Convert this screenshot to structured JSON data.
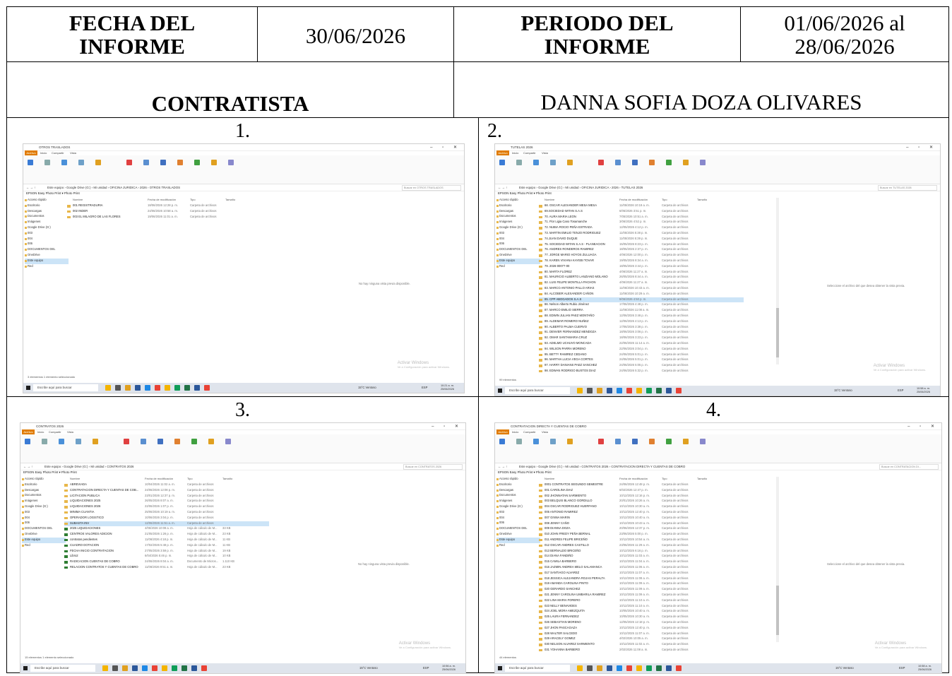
{
  "header": {
    "fecha_label": "FECHA DEL INFORME",
    "fecha_value": "30/06/2026",
    "periodo_label": "PERIODO DEL INFORME",
    "periodo_value_line1": "01/06/2026 al",
    "periodo_value_line2": "28/06/2026",
    "contratista_label": "CONTRATISTA",
    "contratista_value": "DANNA SOFIA DOZA OLIVARES"
  },
  "panels": [
    {
      "number": "1.",
      "window_title": "OTROS TRASLADOS",
      "path": "Este equipo › Google Drive (G:) › Mi unidad › OFICINA JURIDICA › 2026 › OTROS TRASLADOS",
      "search": "Buscar en OTROS TRASLADOS",
      "empty_message": "No hay ninguna vista previa disponible.",
      "status": "3 elementos    1 elemento seleccionado",
      "time": "10:21 a. m.",
      "date": "25/06/2026",
      "items": [
        {
          "name": "001 REGISTRADURIA",
          "date": "18/06/2026 12:28 p. m.",
          "type": "Carpeta de archivos",
          "size": ""
        },
        {
          "name": "002 INDER",
          "date": "24/06/2026 10:58 a. m.",
          "type": "Carpeta de archivos",
          "size": ""
        },
        {
          "name": "003 EL MILAGRO DE LAS FLORES",
          "date": "19/06/2026 11:01 a. m.",
          "type": "Carpeta de archivos",
          "size": ""
        }
      ]
    },
    {
      "number": "2.",
      "window_title": "TUTELAS 2026",
      "path": "Este equipo › Google Drive (G:) › Mi unidad › OFICINA JURIDICA › 2026 › TUTELAS 2026",
      "search": "Buscar en TUTELAS 2026",
      "empty_message": "Seleccione el archivo del que desea obtener la vista previa.",
      "status": "99 elementos",
      "time": "10:58 a. m.",
      "date": "25/06/2026",
      "items": [
        {
          "name": "68. OSCAR ALEXANDER MESA MESA",
          "date": "11/05/2026 10:19 a. m.",
          "type": "Carpeta de archivos",
          "size": ""
        },
        {
          "name": "69.SOCIEDAD WITAN S.A.S",
          "date": "6/05/2026 3:51 p. m.",
          "type": "Carpeta de archivos",
          "size": ""
        },
        {
          "name": "70. AURA MARIA LEON",
          "date": "7/05/2026 10:51 a. m.",
          "type": "Carpeta de archivos",
          "size": ""
        },
        {
          "name": "71. Flor Ligia Cano Tosamanche",
          "date": "3/06/2026 4:52 p. m.",
          "type": "Carpeta de archivos",
          "size": ""
        },
        {
          "name": "72. NUBIA ROCIO PEÑA ESTRADA",
          "date": "12/05/2026 4:12 p. m.",
          "type": "Carpeta de archivos",
          "size": ""
        },
        {
          "name": "73. MARTIN EMILIO TENJO RODRIGUEZ",
          "date": "11/05/2026 5:38 p. m.",
          "type": "Carpeta de archivos",
          "size": ""
        },
        {
          "name": "74.JUAN DAVID DUQUE",
          "date": "11/05/2026 5:39 p. m.",
          "type": "Carpeta de archivos",
          "size": ""
        },
        {
          "name": "75. SOCIEDAD WITAN S.A.S - PLANEACION",
          "date": "15/05/2026 8:23 p. m.",
          "type": "Carpeta de archivos",
          "size": ""
        },
        {
          "name": "76. ANDRES RONDEROS RAMIREZ",
          "date": "18/05/2026 2:37 p. m.",
          "type": "Carpeta de archivos",
          "size": ""
        },
        {
          "name": "77. JORGE MARIO HOYOS ZULUAGA",
          "date": "4/06/2026 12:00 p. m.",
          "type": "Carpeta de archivos",
          "size": ""
        },
        {
          "name": "78. KAREN VIVIANA KAYEBI TOVAR",
          "date": "19/05/2026 8:34 a. m.",
          "type": "Carpeta de archivos",
          "size": ""
        },
        {
          "name": "79. 2026-00077-00",
          "date": "18/05/2026 3:44 p. m.",
          "type": "Carpeta de archivos",
          "size": ""
        },
        {
          "name": "80. MARTA FLOREZ",
          "date": "4/06/2026 11:27 a. m.",
          "type": "Carpeta de archivos",
          "size": ""
        },
        {
          "name": "81. MAURICIO ALBERTO LANZIANO MOLANO",
          "date": "26/05/2026 8:44 a. m.",
          "type": "Carpeta de archivos",
          "size": ""
        },
        {
          "name": "82. LUIS FELIPE MONTILLA PACHON",
          "date": "4/06/2026 11:27 a. m.",
          "type": "Carpeta de archivos",
          "size": ""
        },
        {
          "name": "83. MARCO ANTONIO PALLO ARIAS",
          "date": "11/06/2026 10:43 a. m.",
          "type": "Carpeta de archivos",
          "size": ""
        },
        {
          "name": "84. ALCOBER ALEXANDER CAÑON",
          "date": "11/06/2026 10:29 a. m.",
          "type": "Carpeta de archivos",
          "size": ""
        },
        {
          "name": "85. CPP ABOGADOS S.A.S",
          "date": "9/06/2026 4:50 p. m.",
          "type": "Carpeta de archivos",
          "size": "",
          "selected": true
        },
        {
          "name": "86. Nelson Alberto Rubio Jiménez",
          "date": "17/06/2026 4:48 p. m.",
          "type": "Carpeta de archivos",
          "size": ""
        },
        {
          "name": "87. MARCO EMILIO SIERRA",
          "date": "11/06/2026 11:08 a. m.",
          "type": "Carpeta de archivos",
          "size": ""
        },
        {
          "name": "88. EDWIN JULIAN PAEZ MONTAÑO",
          "date": "12/06/2026 3:46 p. m.",
          "type": "Carpeta de archivos",
          "size": ""
        },
        {
          "name": "89. ALDEMAR ROMERO NUÑEZ",
          "date": "12/06/2026 4:13 p. m.",
          "type": "Carpeta de archivos",
          "size": ""
        },
        {
          "name": "90. ALBERTO PALMA CUERVO",
          "date": "17/06/2026 3:38 p. m.",
          "type": "Carpeta de archivos",
          "size": ""
        },
        {
          "name": "91. DENVER FERNANDEZ MENDOZA",
          "date": "18/06/2026 3:06 p. m.",
          "type": "Carpeta de archivos",
          "size": ""
        },
        {
          "name": "92. OMAR SANTAMARIA CRUZ",
          "date": "18/06/2026 3:23 p. m.",
          "type": "Carpeta de archivos",
          "size": ""
        },
        {
          "name": "93. ADELMO UCHUVO MONCADA",
          "date": "22/06/2026 11:14 a. m.",
          "type": "Carpeta de archivos",
          "size": ""
        },
        {
          "name": "94. WILSON PARRA MORENO",
          "date": "22/06/2026 3:04 p. m.",
          "type": "Carpeta de archivos",
          "size": ""
        },
        {
          "name": "95. BETTY RAMIREZ CEDANO",
          "date": "24/06/2026 5:01 p. m.",
          "type": "Carpeta de archivos",
          "size": ""
        },
        {
          "name": "96. MARTHA LUCIA VEGA CORTES",
          "date": "24/06/2026 5:01 p. m.",
          "type": "Carpeta de archivos",
          "size": ""
        },
        {
          "name": "97. HARRY DANIANS PAEZ SANCHEZ",
          "date": "24/06/2026 5:05 p. m.",
          "type": "Carpeta de archivos",
          "size": ""
        },
        {
          "name": "98. EDWAN RODRIGO BUSTOS DIAZ",
          "date": "24/06/2026 5:32 p. m.",
          "type": "Carpeta de archivos",
          "size": ""
        },
        {
          "name": "CUADRO DE CONTROL TUTELA",
          "date": "25/06/2026 10:23 a. m.",
          "type": "Hoja de cálculo de M...",
          "size": "90 KB"
        }
      ]
    },
    {
      "number": "3.",
      "window_title": "CONTRATOS 2026",
      "path": "Este equipo › Google Drive (G:) › Mi unidad › CONTRATOS 2026",
      "search": "Buscar en CONTRATOS 2026",
      "empty_message": "No hay ninguna vista previa disponible.",
      "status": "15 elementos    1 elemento seleccionado",
      "time": "10:56 a. m.",
      "date": "25/06/2026",
      "items": [
        {
          "name": "ABREVIADA",
          "date": "10/04/2026 11:02 a. m.",
          "type": "Carpeta de archivos",
          "size": ""
        },
        {
          "name": "CONTRATACION DIRECTA Y CUENTAS DE COB...",
          "date": "24/06/2026 12:08 p. m.",
          "type": "Carpeta de archivos",
          "size": ""
        },
        {
          "name": "LICITACION PUBLICA",
          "date": "23/01/2026 12:37 p. m.",
          "type": "Carpeta de archivos",
          "size": ""
        },
        {
          "name": "LIQUIDACIONES 2025",
          "date": "26/05/2026 8:07 a. m.",
          "type": "Carpeta de archivos",
          "size": ""
        },
        {
          "name": "LIQUIDACIONES 2026",
          "date": "22/06/2026 1:07 p. m.",
          "type": "Carpeta de archivos",
          "size": ""
        },
        {
          "name": "MINIMA CUANTIA",
          "date": "25/06/2026 10:19 a. m.",
          "type": "Carpeta de archivos",
          "size": ""
        },
        {
          "name": "OPERADOR LOGISTICO",
          "date": "10/06/2026 3:04 p. m.",
          "type": "Carpeta de archivos",
          "size": ""
        },
        {
          "name": "SUBASTA INV",
          "date": "12/06/2026 11:51 a. m.",
          "type": "Carpeta de archivos",
          "size": "",
          "selected": true
        },
        {
          "name": "2025 LIQUIDACIONES",
          "date": "4/05/2026 10:08 a. m.",
          "type": "Hoja de cálculo de M...",
          "size": "33 KB"
        },
        {
          "name": "CENTROS VALORES ADICION",
          "date": "21/05/2026 1:26 p. m.",
          "type": "Hoja de cálculo de M...",
          "size": "23 KB"
        },
        {
          "name": "contratos pendientes",
          "date": "11/06/2026 4:18 p. m.",
          "type": "Hoja de cálculo de M...",
          "size": "11 KB"
        },
        {
          "name": "CUADRO DOTACION",
          "date": "17/02/2026 5:48 p. m.",
          "type": "Hoja de cálculo de M...",
          "size": "11 KB"
        },
        {
          "name": "FECHA INICIO CONTRATACION",
          "date": "27/05/2026 3:59 p. m.",
          "type": "Hoja de cálculo de M...",
          "size": "19 KB"
        },
        {
          "name": "Libro2",
          "date": "6/04/2026 5:46 p. m.",
          "type": "Hoja de cálculo de M...",
          "size": "10 KB"
        },
        {
          "name": "RADICACION CUENTAS DE COBRO",
          "date": "24/06/2026 8:04 a. m.",
          "type": "Documento de Micros...",
          "size": "1.110 KB"
        },
        {
          "name": "RELACION CONTRATOS Y CUENTAS DE COBRO",
          "date": "11/06/2026 9:51 a. m.",
          "type": "Hoja de cálculo de M...",
          "size": "23 KB"
        }
      ]
    },
    {
      "number": "4.",
      "window_title": "CONTRATACION DIRECTA Y CUENTAS DE COBRO",
      "path": "Este equipo › Google Drive (G:) › Mi unidad › CONTRATOS 2026 › CONTRATACION DIRECTA Y CUENTAS DE COBRO",
      "search": "Buscar en CONTRATACION DI...",
      "empty_message": "Seleccione el archivo del que desea obtener la vista previa.",
      "status": "44 elementos",
      "time": "10:58 a. m.",
      "date": "25/06/2026",
      "items": [
        {
          "name": "0001 CONTRATOS SEGUNDO SEMESTRE",
          "date": "24/06/2026 12:48 p. m.",
          "type": "Carpeta de archivos",
          "size": ""
        },
        {
          "name": "001 CAROLINA DIAZ",
          "date": "6/02/2026 12:47 p. m.",
          "type": "Carpeta de archivos",
          "size": ""
        },
        {
          "name": "002 JHONNATAN SARMIENTO",
          "date": "10/12/2025 12:16 p. m.",
          "type": "Carpeta de archivos",
          "size": ""
        },
        {
          "name": "003 BELQUIS BLANCO GORDILLO",
          "date": "20/01/2026 10:26 a. m.",
          "type": "Carpeta de archivos",
          "size": ""
        },
        {
          "name": "004 OSCAR RODRIGUEZ HUERFANO",
          "date": "10/12/2025 10:30 a. m.",
          "type": "Carpeta de archivos",
          "size": ""
        },
        {
          "name": "005 ANTONIO RAMIREZ",
          "date": "10/12/2025 12:40 p. m.",
          "type": "Carpeta de archivos",
          "size": ""
        },
        {
          "name": "007 GINNA MARIN",
          "date": "10/12/2025 10:40 a. m.",
          "type": "Carpeta de archivos",
          "size": ""
        },
        {
          "name": "008 JENNY CAÑO",
          "date": "10/12/2025 10:43 a. m.",
          "type": "Carpeta de archivos",
          "size": ""
        },
        {
          "name": "009 DIANNA DOZA",
          "date": "20/06/2026 12:37 p. m.",
          "type": "Carpeta de archivos",
          "size": ""
        },
        {
          "name": "010 JOHN FREDY PEÑA BERNAL",
          "date": "23/06/2026 5:00 p. m.",
          "type": "Carpeta de archivos",
          "size": ""
        },
        {
          "name": "011 ANDRES FELIPE BRICEÑO",
          "date": "10/12/2025 10:54 a. m.",
          "type": "Carpeta de archivos",
          "size": ""
        },
        {
          "name": "012 OSCAR ANDRES CASTILLO",
          "date": "23/06/2026 11:29 a. m.",
          "type": "Carpeta de archivos",
          "size": ""
        },
        {
          "name": "013 BERNALDO BRICEÑO",
          "date": "10/12/2025 6:16 p. m.",
          "type": "Carpeta de archivos",
          "size": ""
        },
        {
          "name": "014 DIANA FANDIÑO",
          "date": "10/12/2025 11:03 a. m.",
          "type": "Carpeta de archivos",
          "size": ""
        },
        {
          "name": "015 CAMILA BARBERO",
          "date": "10/12/2025 11:04 a. m.",
          "type": "Carpeta de archivos",
          "size": ""
        },
        {
          "name": "016 JAZMIN ANDREA MELO SALAMANCA",
          "date": "10/12/2025 11:06 a. m.",
          "type": "Carpeta de archivos",
          "size": ""
        },
        {
          "name": "017 SANTIAGO ALVAREZ",
          "date": "10/12/2025 11:07 a. m.",
          "type": "Carpeta de archivos",
          "size": ""
        },
        {
          "name": "018 JESSICA ALEJANDRA ROJAS PERALTA",
          "date": "10/12/2025 11:08 a. m.",
          "type": "Carpeta de archivos",
          "size": ""
        },
        {
          "name": "019 AMANDA CAROLINA PINTO",
          "date": "10/12/2025 11:09 a. m.",
          "type": "Carpeta de archivos",
          "size": ""
        },
        {
          "name": "020 GERARDO SANCHEZ",
          "date": "10/12/2025 11:09 a. m.",
          "type": "Carpeta de archivos",
          "size": ""
        },
        {
          "name": "021 JENNY CAROLINA UMBARILA RAMIREZ",
          "date": "10/12/2025 11:09 a. m.",
          "type": "Carpeta de archivos",
          "size": ""
        },
        {
          "name": "022 LINA MARIA FORERO",
          "date": "10/12/2025 11:10 a. m.",
          "type": "Carpeta de archivos",
          "size": ""
        },
        {
          "name": "023 NELLY BENAVIDES",
          "date": "10/12/2025 11:10 a. m.",
          "type": "Carpeta de archivos",
          "size": ""
        },
        {
          "name": "024 JOEL MORA AMEZQUITA",
          "date": "10/05/2026 10:40 a. m.",
          "type": "Carpeta de archivos",
          "size": ""
        },
        {
          "name": "025 LAURA FERNANDEZ",
          "date": "10/05/2026 10:30 a. m.",
          "type": "Carpeta de archivos",
          "size": ""
        },
        {
          "name": "026 SEBASTIAN MORENO",
          "date": "12/05/2026 12:18 p. m.",
          "type": "Carpeta de archivos",
          "size": ""
        },
        {
          "name": "027 JHON PASCAGAZA",
          "date": "10/12/2025 12:40 p. m.",
          "type": "Carpeta de archivos",
          "size": ""
        },
        {
          "name": "028 WALTER SALCEDO",
          "date": "10/12/2025 11:07 a. m.",
          "type": "Carpeta de archivos",
          "size": ""
        },
        {
          "name": "029 ARACELY GOMEZ",
          "date": "4/02/2026 10:05 a. m.",
          "type": "Carpeta de archivos",
          "size": ""
        },
        {
          "name": "030 NELSON ALVAREZ SARMIENTO",
          "date": "10/12/2025 11:02 a. m.",
          "type": "Carpeta de archivos",
          "size": ""
        },
        {
          "name": "031 YOHANNA BARBERO",
          "date": "2/02/2026 11:08 a. m.",
          "type": "Carpeta de archivos",
          "size": ""
        }
      ]
    }
  ],
  "common": {
    "menu_file": "Archivo",
    "menu_home": "Inicio",
    "menu_share": "Compartir",
    "menu_view": "Vista",
    "col_name": "Nombre",
    "col_date": "Fecha de modificación",
    "col_type": "Tipo",
    "col_size": "Tamaño",
    "epson_bar": "EPSON Easy Photo Print  ▾  Photo Print",
    "watermark_title": "Activar Windows",
    "watermark_sub": "Ve a Configuración para activar Windows.",
    "taskbar_search": "Escribe aquí para buscar",
    "weather": "15°C  Ventoso",
    "lang": "ESP",
    "nav_items": [
      "Acceso rápido",
      "Escritorio",
      "Descargas",
      "Documentos",
      "Imágenes",
      "Google Drive (G:)",
      "003",
      "004",
      "006",
      "DOCUMENTOS DEL",
      "OneDrive",
      "Este equipo",
      "Red"
    ]
  }
}
